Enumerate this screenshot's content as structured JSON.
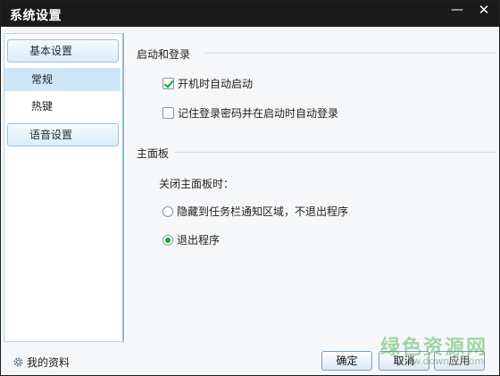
{
  "window": {
    "title": "系统设置",
    "minimize_icon": "minimize-icon",
    "close_icon": "close-icon",
    "minimize_glyph": "—",
    "close_glyph": "✕"
  },
  "sidebar": {
    "groups": [
      {
        "label": "基本设置",
        "items": [
          {
            "label": "常规",
            "active": true
          },
          {
            "label": "热键",
            "active": false
          }
        ]
      },
      {
        "label": "语音设置",
        "items": []
      }
    ]
  },
  "sections": {
    "login": {
      "title": "启动和登录",
      "options": [
        {
          "label": "开机时自动启动",
          "checked": true
        },
        {
          "label": "记住登录密码并在启动时自动登录",
          "checked": false
        }
      ]
    },
    "panel": {
      "title": "主面板",
      "prompt": "关闭主面板时：",
      "options": [
        {
          "label": "隐藏到任务栏通知区域，不退出程序",
          "selected": false
        },
        {
          "label": "退出程序",
          "selected": true
        }
      ]
    }
  },
  "footer": {
    "profile_label": "我的资料",
    "profile_icon": "gear-icon",
    "ok_label": "确定",
    "cancel_label": "取消",
    "apply_label": "应用"
  },
  "watermark": {
    "text": "绿色资源网",
    "url": "www.downcc.com"
  },
  "colors": {
    "titlebar": "#1b1b1b",
    "accent_check": "#16a034",
    "nav_active": "#cfe6f7"
  }
}
